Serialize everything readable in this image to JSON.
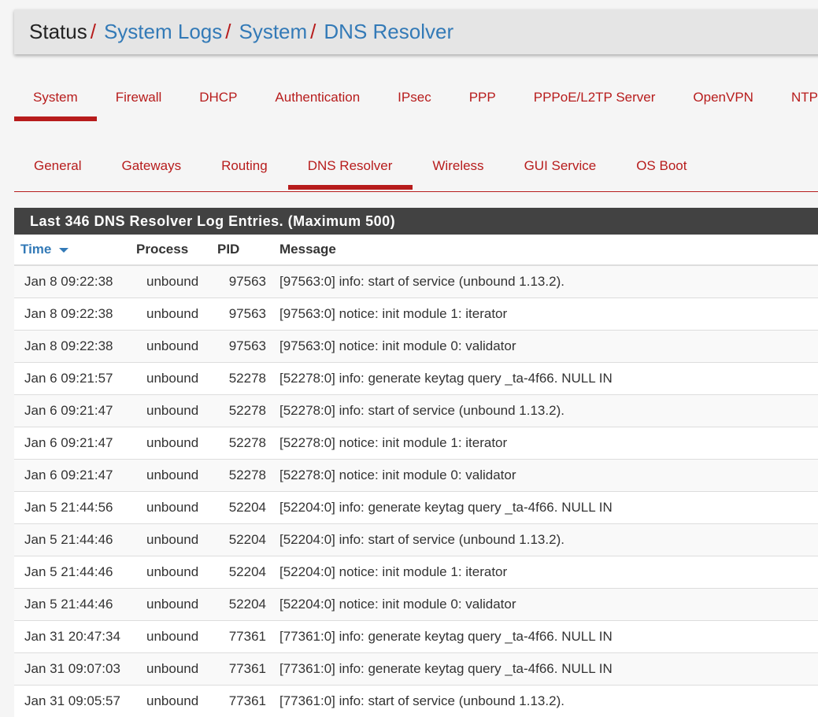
{
  "breadcrumb": {
    "root": "Status",
    "items": [
      "System Logs",
      "System",
      "DNS Resolver"
    ],
    "sep": "/"
  },
  "tabs": [
    "System",
    "Firewall",
    "DHCP",
    "Authentication",
    "IPsec",
    "PPP",
    "PPPoE/L2TP Server",
    "OpenVPN",
    "NTP"
  ],
  "subtabs": [
    "General",
    "Gateways",
    "Routing",
    "DNS Resolver",
    "Wireless",
    "GUI Service",
    "OS Boot"
  ],
  "active_tab": "System",
  "active_subtab": "DNS Resolver",
  "panel_title": "Last 346 DNS Resolver Log Entries. (Maximum 500)",
  "columns": [
    "Time",
    "Process",
    "PID",
    "Message"
  ],
  "sort_icon": "caret-down-icon",
  "rows": [
    [
      "Jan 8 09:22:38",
      "unbound",
      "97563",
      "[97563:0] info: start of service (unbound 1.13.2)."
    ],
    [
      "Jan 8 09:22:38",
      "unbound",
      "97563",
      "[97563:0] notice: init module 1: iterator"
    ],
    [
      "Jan 8 09:22:38",
      "unbound",
      "97563",
      "[97563:0] notice: init module 0: validator"
    ],
    [
      "Jan 6 09:21:57",
      "unbound",
      "52278",
      "[52278:0] info: generate keytag query _ta-4f66. NULL IN"
    ],
    [
      "Jan 6 09:21:47",
      "unbound",
      "52278",
      "[52278:0] info: start of service (unbound 1.13.2)."
    ],
    [
      "Jan 6 09:21:47",
      "unbound",
      "52278",
      "[52278:0] notice: init module 1: iterator"
    ],
    [
      "Jan 6 09:21:47",
      "unbound",
      "52278",
      "[52278:0] notice: init module 0: validator"
    ],
    [
      "Jan 5 21:44:56",
      "unbound",
      "52204",
      "[52204:0] info: generate keytag query _ta-4f66. NULL IN"
    ],
    [
      "Jan 5 21:44:46",
      "unbound",
      "52204",
      "[52204:0] info: start of service (unbound 1.13.2)."
    ],
    [
      "Jan 5 21:44:46",
      "unbound",
      "52204",
      "[52204:0] notice: init module 1: iterator"
    ],
    [
      "Jan 5 21:44:46",
      "unbound",
      "52204",
      "[52204:0] notice: init module 0: validator"
    ],
    [
      "Jan 31 20:47:34",
      "unbound",
      "77361",
      "[77361:0] info: generate keytag query _ta-4f66. NULL IN"
    ],
    [
      "Jan 31 09:07:03",
      "unbound",
      "77361",
      "[77361:0] info: generate keytag query _ta-4f66. NULL IN"
    ],
    [
      "Jan 31 09:05:57",
      "unbound",
      "77361",
      "[77361:0] info: start of service (unbound 1.13.2)."
    ]
  ]
}
